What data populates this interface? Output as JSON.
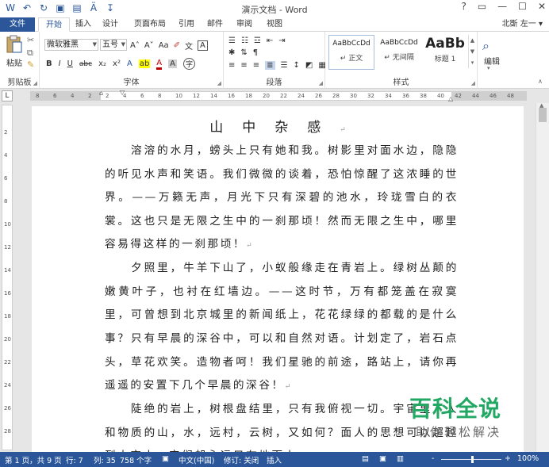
{
  "window": {
    "title": "演示文档 - Word",
    "help": "?",
    "controls": [
      "▭",
      "—",
      "☐",
      "✕"
    ]
  },
  "quick_access": [
    "W",
    "↶",
    "↻",
    "▣",
    "▤",
    "Ä",
    "↧"
  ],
  "tabs": [
    "文件",
    "开始",
    "插入",
    "设计",
    "页面布局",
    "引用",
    "邮件",
    "审阅",
    "视图"
  ],
  "user": "北斲 左一 ▾",
  "ribbon": {
    "clipboard": {
      "paste": "粘贴",
      "label": "剪贴板"
    },
    "font": {
      "family": "微软雅黑",
      "size": "五号",
      "label": "字体",
      "grow": "A˄",
      "shrink": "A˅",
      "bold": "B",
      "italic": "I",
      "underline": "U",
      "strike": "abc",
      "sub": "x₂",
      "sup": "x²",
      "case": "Aa"
    },
    "paragraph": {
      "label": "段落"
    },
    "styles": {
      "label": "样式",
      "items": [
        {
          "preview": "AaBbCcDd",
          "name": "↵ 正文"
        },
        {
          "preview": "AaBbCcDd",
          "name": "↵ 无间隔"
        },
        {
          "preview": "AaBb",
          "name": "标题 1"
        }
      ]
    },
    "editing": {
      "label": "编辑"
    }
  },
  "ruler": {
    "numbers": [
      "8",
      "6",
      "4",
      "2",
      "2",
      "4",
      "6",
      "8",
      "10",
      "12",
      "14",
      "16",
      "18",
      "20",
      "22",
      "24",
      "26",
      "28",
      "30",
      "32",
      "34",
      "36",
      "38",
      "40",
      "42",
      "44",
      "46",
      "48"
    ],
    "vnumbers": [
      "2",
      "4",
      "6",
      "8",
      "10",
      "12",
      "14",
      "16",
      "18",
      "20",
      "22",
      "24",
      "26",
      "28"
    ]
  },
  "document": {
    "title": "山中杂感",
    "title_mark": "↵",
    "paragraphs": [
      {
        "text": "　　溶溶的水月，螃头上只有她和我。树影里对面水边，隐隐的听见水声和笑语。我们微微的谈着，恐怕惊醒了这浓睡的世界。——万籁无声，月光下只有深碧的池水，玲珑雪白的衣裳。这也只是无限之生中的一刹那顷！然而无限之生中，哪里容易得这样的一刹那顷！",
        "mark": "↵"
      },
      {
        "text": "　　夕照里，牛羊下山了，小蚁般缘走在青岩上。绿树丛颠的嫩黄叶子，也衬在红墙边。——这时节，万有都笼盖在寂寞里，可曾想到北京城里的新闻纸上，花花绿绿的都载的是什么事？",
        "mark": "↵"
      },
      {
        "text": "　　只有早晨的深谷中，可以和自然对语。计划定了，岩石点头，草花欢笑。造物者呵！我们星驰的前途，路站上，请你再遥遥的安置下几个早晨的深谷！",
        "mark": "↵"
      },
      {
        "text": "　　陡绝的岩上，树根盘结里，只有我俯视一切。宇宙里，人和物质的山，水，远村，云树，又如何？面人的思想可以超越到太空中，它们却永远只在地面上。",
        "mark": ""
      }
    ]
  },
  "status": {
    "page": "第 1 页，共 9 页",
    "line": "行: 7",
    "column": "列: 35",
    "words": "758 个字",
    "lang": "中文(中国)",
    "track": "修订: 关闭",
    "mode": "插入",
    "zoom": "100%",
    "zoom_minus": "-",
    "zoom_plus": "+",
    "zoom_level": 100
  },
  "watermark": {
    "main": "百科全说",
    "sub": "助你轻松解决"
  },
  "colors": {
    "accent": "#2b579a",
    "watermark": "#23a864"
  }
}
